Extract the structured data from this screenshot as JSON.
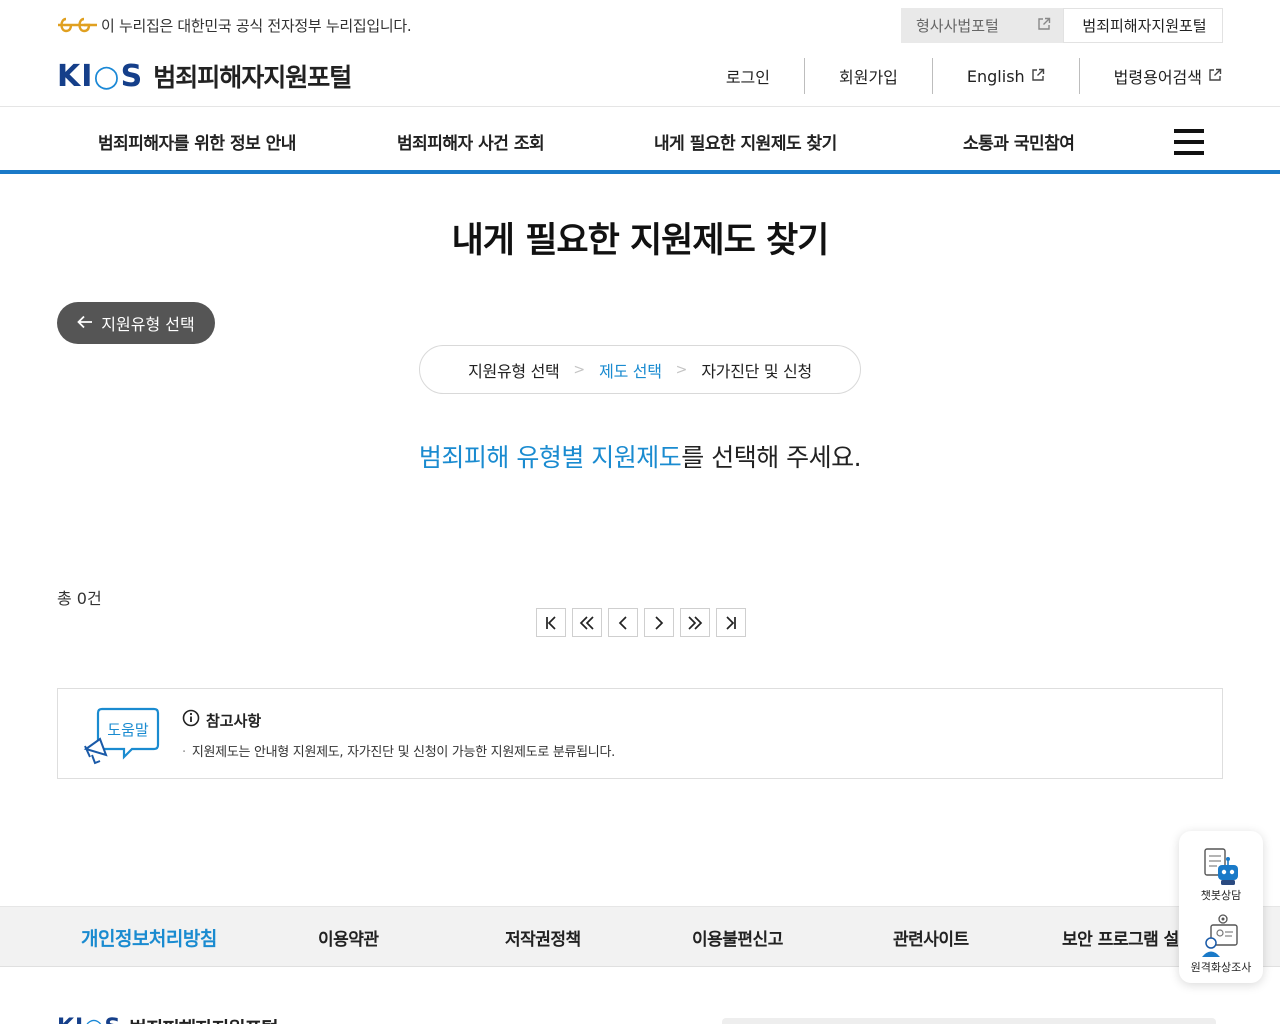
{
  "gov_banner": {
    "text": "이 누리집은 대한민국 공식 전자정부 누리집입니다."
  },
  "portal_tabs": [
    {
      "label": "형사사법포털"
    },
    {
      "label": "범죄피해자지원포털"
    }
  ],
  "logo": {
    "kics_left": "KI",
    "kics_mid": "C",
    "kics_right": "S",
    "title": "범죄피해자지원포털"
  },
  "util_menu": [
    {
      "label": "로그인"
    },
    {
      "label": "회원가입"
    },
    {
      "label": "English"
    },
    {
      "label": "법령용어검색"
    }
  ],
  "gnb": [
    {
      "label": "범죄피해자를 위한 정보 안내"
    },
    {
      "label": "범죄피해자 사건 조회"
    },
    {
      "label": "내게 필요한 지원제도 찾기"
    },
    {
      "label": "소통과 국민참여"
    }
  ],
  "main": {
    "title": "내게 필요한 지원제도 찾기",
    "back_button": "지원유형 선택",
    "steps": [
      {
        "label": "지원유형 선택"
      },
      {
        "label": "제도 선택"
      },
      {
        "label": "자가진단 및 신청"
      }
    ],
    "step_separator": ">",
    "guide_highlight": "범죄피해 유형별 지원제도",
    "guide_rest": "를 선택해 주세요.",
    "total": "총 0건"
  },
  "note": {
    "badge": "도움말",
    "heading": "참고사항",
    "bullet": "·",
    "text": "지원제도는 안내형 지원제도, 자가진단 및 신청이 가능한 지원제도로 분류됩니다."
  },
  "floating": [
    {
      "label": "챗봇상담"
    },
    {
      "label": "원격화상조사"
    }
  ],
  "footer_nav": [
    {
      "label": "개인정보처리방침"
    },
    {
      "label": "이용약관"
    },
    {
      "label": "저작권정책"
    },
    {
      "label": "이용불편신고"
    },
    {
      "label": "관련사이트"
    },
    {
      "label": "보안 프로그램 설치"
    }
  ],
  "footer_logo": {
    "title": "범죄피해자지원포털"
  },
  "colors": {
    "accent": "#1a8bd0",
    "navy": "#153f8a",
    "gnb_border": "#1a7ac8",
    "back_button": "#555555"
  },
  "icons": [
    "government-mark-icon",
    "external-link-icon",
    "hamburger-menu-icon",
    "arrow-left-icon",
    "chevron-right-icon",
    "first-page-icon",
    "prev-group-icon",
    "prev-page-icon",
    "next-page-icon",
    "next-group-icon",
    "last-page-icon",
    "megaphone-speech-icon",
    "info-circle-icon",
    "chatbot-icon",
    "video-call-icon"
  ]
}
